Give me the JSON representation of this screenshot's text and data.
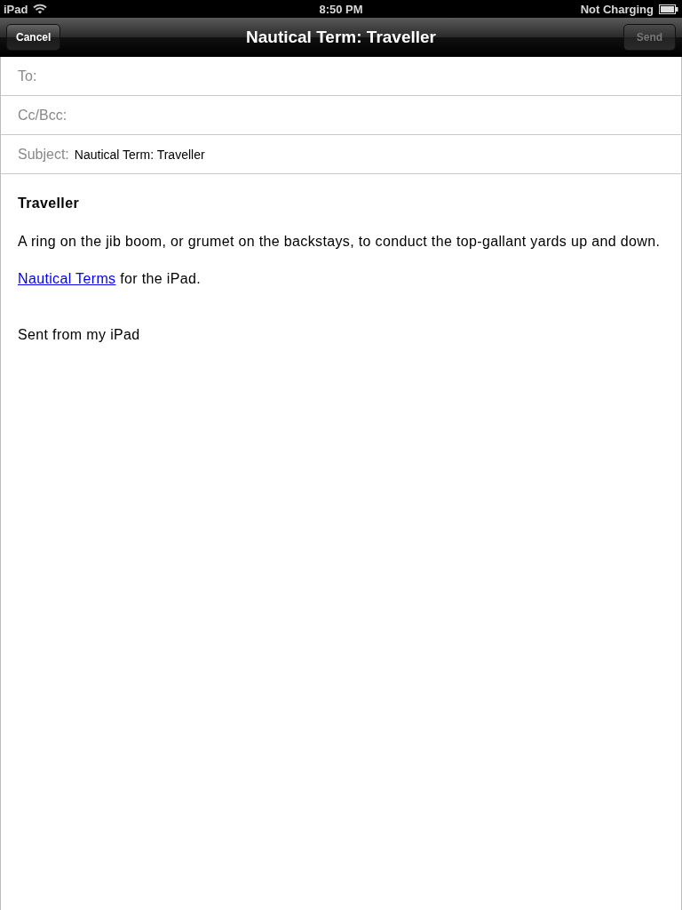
{
  "status_bar": {
    "device": "iPad",
    "time": "8:50 PM",
    "battery_text": "Not Charging"
  },
  "nav_bar": {
    "title": "Nautical Term: Traveller",
    "cancel": {
      "label": "Cancel",
      "disabled": false
    },
    "send": {
      "label": "Send",
      "disabled": true
    }
  },
  "fields": [
    {
      "label": "To:"
    },
    {
      "label": "Cc/Bcc:"
    },
    {
      "label": "Subject:",
      "value": "Nautical Term: Traveller"
    }
  ],
  "body": {
    "heading": "Traveller",
    "paragraph": "A ring on the jib boom, or grumet on the backstays, to conduct the top-gallant yards up and down.",
    "link_line": {
      "link": "Nautical Terms",
      "text": " for the iPad."
    },
    "signature": "Sent from my iPad"
  }
}
